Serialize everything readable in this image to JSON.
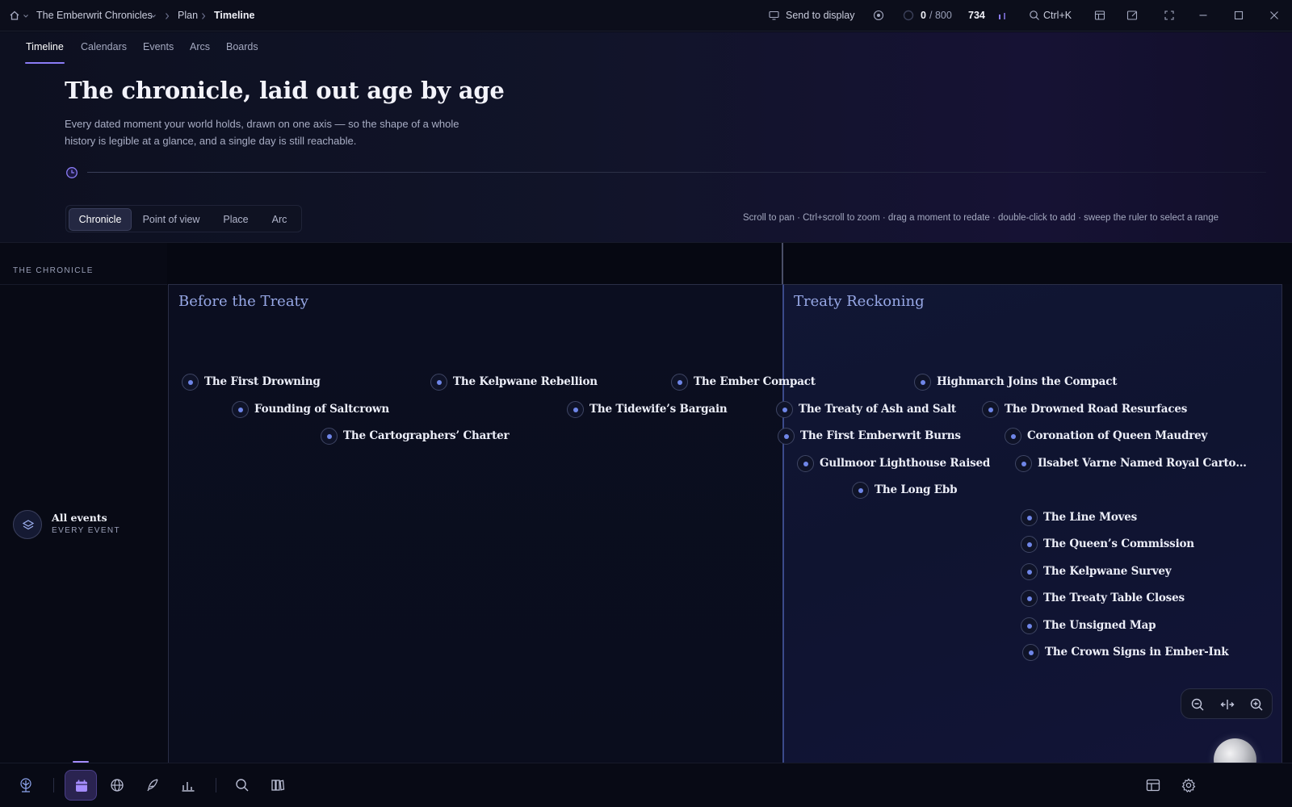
{
  "titlebar": {
    "project": "The Emberwrit Chronicles",
    "crumb_plan": "Plan",
    "crumb_current": "Timeline",
    "send_to_display": "Send to display",
    "progress_current": "0",
    "progress_total": "/ 800",
    "counter": "734",
    "search_shortcut": "Ctrl+K"
  },
  "tabs": [
    "Timeline",
    "Calendars",
    "Events",
    "Arcs",
    "Boards"
  ],
  "header": {
    "title": "The chronicle, laid out age by age",
    "description": "Every dated moment your world holds, drawn on one axis — so the shape of a whole history is legible at a glance, and a single day is still reachable."
  },
  "views": [
    "Chronicle",
    "Point of view",
    "Place",
    "Arc"
  ],
  "active_view": "Chronicle",
  "hint": "Scroll to pan · Ctrl+scroll to zoom · drag a moment to redate · double-click to add · sweep the ruler to select a range",
  "sidebar": {
    "title": "THE CHRONICLE",
    "lane_name": "All events",
    "lane_sub": "EVERY EVENT"
  },
  "eras": [
    "Before the Treaty",
    "Treaty Reckoning"
  ],
  "moments": [
    "The First Drowning",
    "Founding of Saltcrown",
    "The Cartographers’ Charter",
    "The Kelpwane Rebellion",
    "The Tidewife’s Bargain",
    "The Ember Compact",
    "The Treaty of Ash and Salt",
    "The First Emberwrit Burns",
    "Gullmoor Lighthouse Raised",
    "The Long Ebb",
    "Highmarch Joins the Compact",
    "The Drowned Road Resurfaces",
    "Coronation of Queen Maudrey",
    "Ilsabet Varne Named Royal Carto…",
    "The Line Moves",
    "The Queen’s Commission",
    "The Kelpwane Survey",
    "The Treaty Table Closes",
    "The Unsigned Map",
    "The Crown Signs in Ember-Ink"
  ],
  "colors": {
    "accent": "#8b7cf6",
    "era_label": "#97a8e6",
    "moment_dot": "#6f86e8"
  }
}
